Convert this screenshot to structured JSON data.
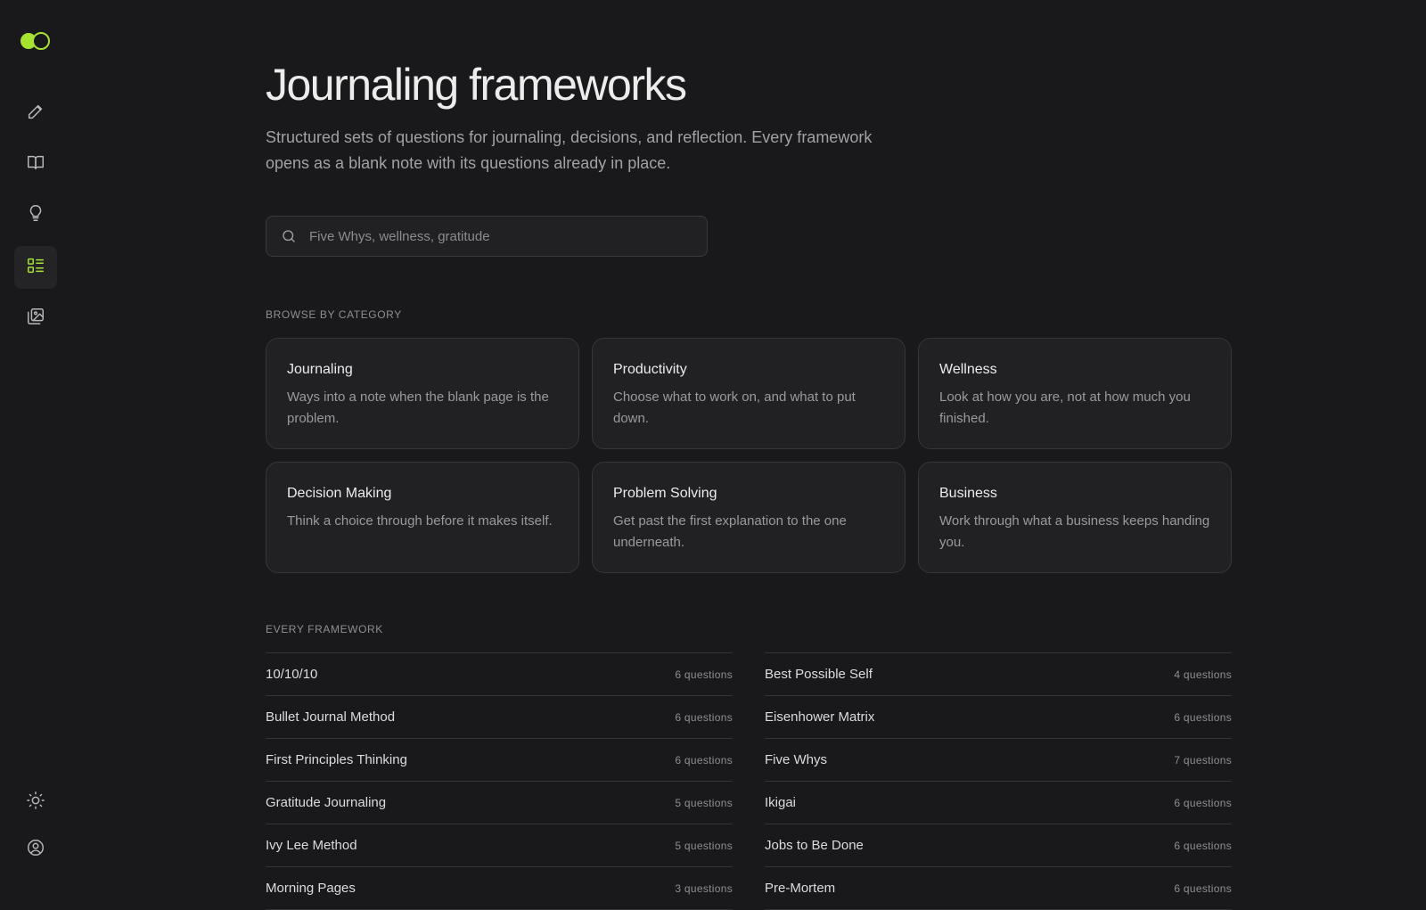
{
  "sidebar": {
    "items": [
      {
        "id": "write",
        "icon": "pencil-icon",
        "active": false
      },
      {
        "id": "read",
        "icon": "book-open-icon",
        "active": false
      },
      {
        "id": "ideas",
        "icon": "lightbulb-icon",
        "active": false
      },
      {
        "id": "frameworks",
        "icon": "list-grid-icon",
        "active": true
      },
      {
        "id": "gallery",
        "icon": "image-stack-icon",
        "active": false
      }
    ],
    "bottom": [
      {
        "id": "theme",
        "icon": "sun-icon"
      },
      {
        "id": "account",
        "icon": "user-circle-icon"
      }
    ],
    "accent": "#a6e22e"
  },
  "page": {
    "title": "Journaling frameworks",
    "subtitle": "Structured sets of questions for journaling, decisions, and reflection. Every framework opens as a blank note with its questions already in place."
  },
  "search": {
    "placeholder": "Five Whys, wellness, gratitude",
    "value": ""
  },
  "categories": {
    "label": "BROWSE BY CATEGORY",
    "items": [
      {
        "title": "Journaling",
        "desc": "Ways into a note when the blank page is the problem."
      },
      {
        "title": "Productivity",
        "desc": "Choose what to work on, and what to put down."
      },
      {
        "title": "Wellness",
        "desc": "Look at how you are, not at how much you finished."
      },
      {
        "title": "Decision Making",
        "desc": "Think a choice through before it makes itself."
      },
      {
        "title": "Problem Solving",
        "desc": "Get past the first explanation to the one underneath."
      },
      {
        "title": "Business",
        "desc": "Work through what a business keeps handing you."
      }
    ]
  },
  "frameworks": {
    "label": "EVERY FRAMEWORK",
    "left": [
      {
        "name": "10/10/10",
        "count": "6 questions"
      },
      {
        "name": "Bullet Journal Method",
        "count": "6 questions"
      },
      {
        "name": "First Principles Thinking",
        "count": "6 questions"
      },
      {
        "name": "Gratitude Journaling",
        "count": "5 questions"
      },
      {
        "name": "Ivy Lee Method",
        "count": "5 questions"
      },
      {
        "name": "Morning Pages",
        "count": "3 questions"
      }
    ],
    "right": [
      {
        "name": "Best Possible Self",
        "count": "4 questions"
      },
      {
        "name": "Eisenhower Matrix",
        "count": "6 questions"
      },
      {
        "name": "Five Whys",
        "count": "7 questions"
      },
      {
        "name": "Ikigai",
        "count": "6 questions"
      },
      {
        "name": "Jobs to Be Done",
        "count": "6 questions"
      },
      {
        "name": "Pre-Mortem",
        "count": "6 questions"
      }
    ]
  }
}
